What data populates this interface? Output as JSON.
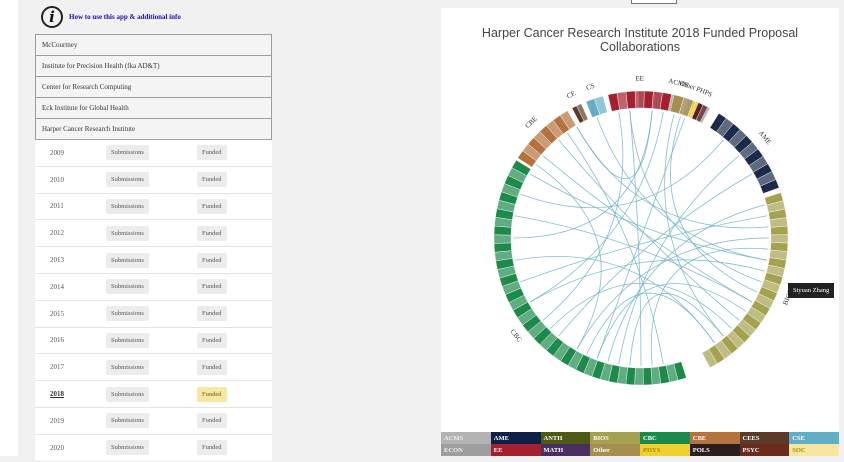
{
  "info": {
    "icon": "info-icon",
    "link_text": "How to use this app & additional info"
  },
  "institutes": [
    "McCourtney",
    "Institute for Precision Health (fka AD&T)",
    "Center for Research Computing",
    "Eck Institute for Global Health",
    "Harper Cancer Research Institute"
  ],
  "years": [
    {
      "year": "2009",
      "submissions": "Submissions",
      "funded": "Funded"
    },
    {
      "year": "2010",
      "submissions": "Submissions",
      "funded": "Funded"
    },
    {
      "year": "2011",
      "submissions": "Submissions",
      "funded": "Funded"
    },
    {
      "year": "2012",
      "submissions": "Submissions",
      "funded": "Funded"
    },
    {
      "year": "2013",
      "submissions": "Submissions",
      "funded": "Funded"
    },
    {
      "year": "2014",
      "submissions": "Submissions",
      "funded": "Funded"
    },
    {
      "year": "2015",
      "submissions": "Submissions",
      "funded": "Funded"
    },
    {
      "year": "2016",
      "submissions": "Submissions",
      "funded": "Funded"
    },
    {
      "year": "2017",
      "submissions": "Submissions",
      "funded": "Funded"
    },
    {
      "year": "2018",
      "submissions": "Submissions",
      "funded": "Funded",
      "selected": true
    },
    {
      "year": "2019",
      "submissions": "Submissions",
      "funded": "Funded"
    },
    {
      "year": "2020",
      "submissions": "Submissions",
      "funded": "Funded"
    }
  ],
  "chart": {
    "title": "Harper Cancer Research Institute 2018 Funded Proposal Collaborations",
    "tooltip": "Siyuan Zhang",
    "groups": [
      {
        "label": "ACMS",
        "color": "#b3b3b3"
      },
      {
        "label": "AME",
        "color": "#1b2a4a"
      },
      {
        "label": "BIOS",
        "color": "#a4a14f"
      },
      {
        "label": "CBC",
        "color": "#1b8a4a"
      },
      {
        "label": "CBE",
        "color": "#b4723c"
      },
      {
        "label": "CE",
        "color": "#5b3a2a"
      },
      {
        "label": "CS",
        "color": "#62aec4"
      },
      {
        "label": "EE",
        "color": "#a51f2f"
      },
      {
        "label": "Other",
        "color": "#a58f4f"
      },
      {
        "label": "PH",
        "color": "#f2cf2a"
      },
      {
        "label": "PS",
        "color": "#5a1d1d"
      }
    ]
  },
  "legend": [
    {
      "label": "ACMS",
      "color": "#b3b3b3"
    },
    {
      "label": "AME",
      "color": "#0e2148"
    },
    {
      "label": "ANTH",
      "color": "#4d5a15"
    },
    {
      "label": "BIOS",
      "color": "#a4a14f"
    },
    {
      "label": "CBC",
      "color": "#1b8a4a"
    },
    {
      "label": "CBE",
      "color": "#b4723c"
    },
    {
      "label": "CEES",
      "color": "#5b3a2a"
    },
    {
      "label": "CSE",
      "color": "#62aec4"
    },
    {
      "label": "ECON",
      "color": "#9e9e9e"
    },
    {
      "label": "EE",
      "color": "#a51f2f"
    },
    {
      "label": "MATH",
      "color": "#4a2e5f"
    },
    {
      "label": "Other",
      "color": "#a58f4f"
    },
    {
      "label": "PHYS",
      "color": "#f2cf2a"
    },
    {
      "label": "POLS",
      "color": "#2a1e1e"
    },
    {
      "label": "PSYC",
      "color": "#6a2a1c"
    },
    {
      "label": "SOC",
      "color": "#f5e6a0"
    }
  ]
}
